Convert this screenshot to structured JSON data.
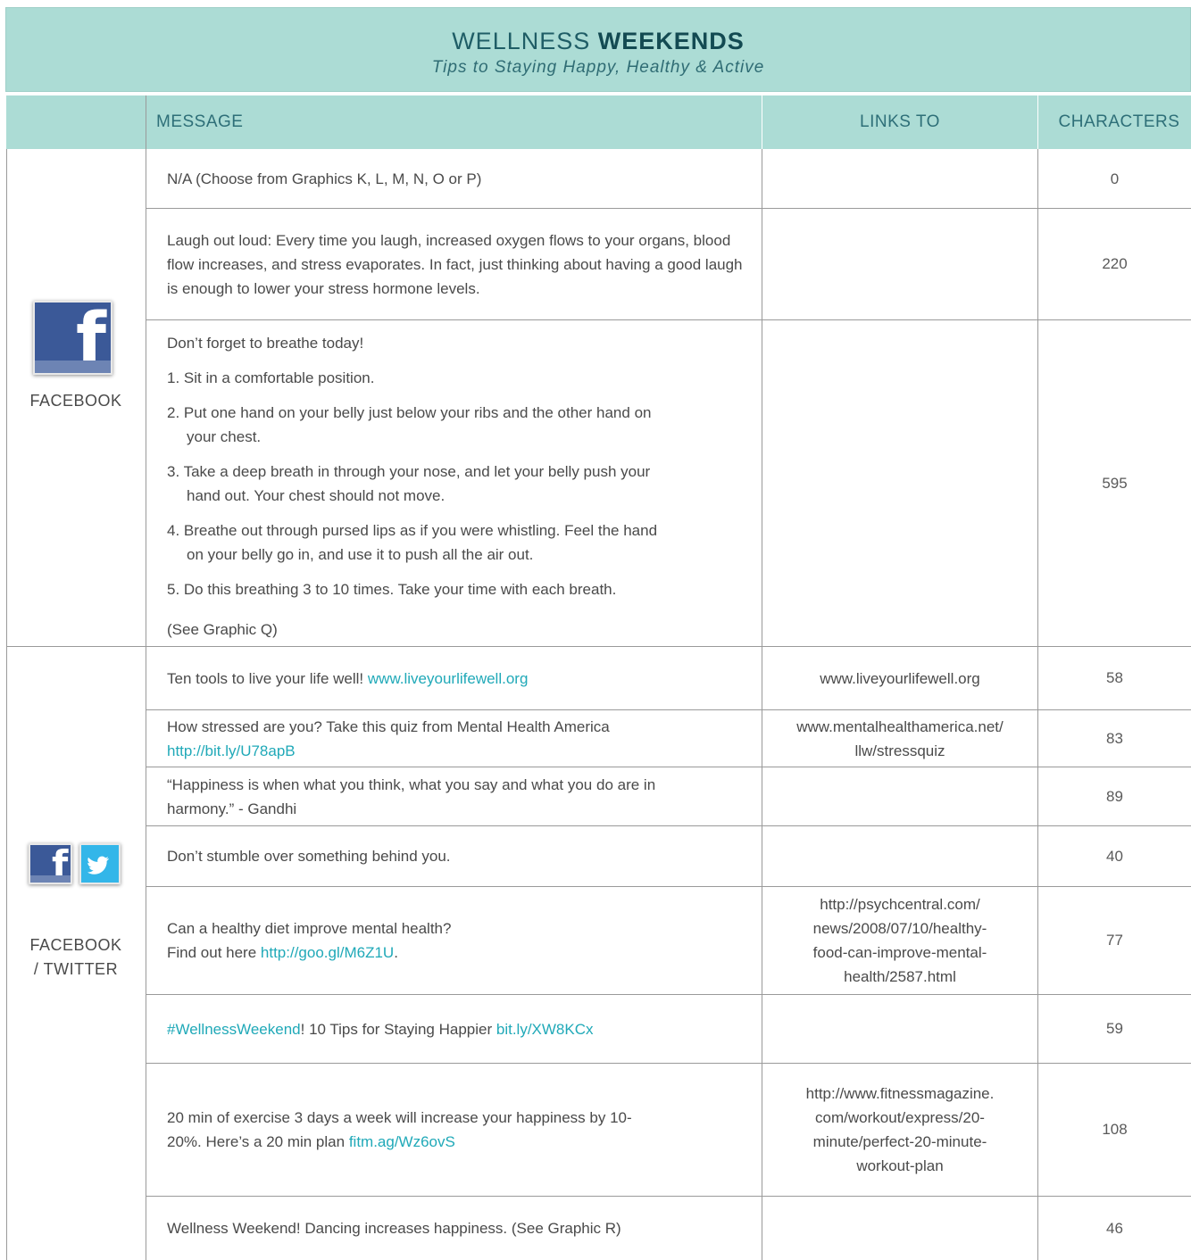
{
  "banner": {
    "title_light": "WELLNESS ",
    "title_bold": "WEEKENDS",
    "subtitle": "Tips to Staying Happy, Healthy & Active"
  },
  "columns": {
    "message": "MESSAGE",
    "links_to": "LINKS TO",
    "characters": "CHARACTERS"
  },
  "platforms": {
    "facebook": "FACEBOOK",
    "fb_twitter_1": "FACEBOOK",
    "fb_twitter_2": "/ TWITTER"
  },
  "icons": {
    "facebook": "facebook-icon",
    "twitter": "twitter-icon"
  },
  "colors": {
    "accent": "#acdcd5",
    "link": "#20a9b8",
    "facebook": "#3b5998",
    "twitter": "#33b6e9"
  },
  "rows": {
    "r1": {
      "message": "N/A (Choose from Graphics K, L, M, N, O or P)",
      "chars": "0"
    },
    "r2": {
      "message": "Laugh out loud:  Every time you laugh, increased oxygen flows to your organs, blood flow increases, and stress evaporates. In fact, just thinking about having a good laugh is enough to lower your stress hormone levels.",
      "chars": "220"
    },
    "r3": {
      "intro": "Don’t forget to breathe today!",
      "s1": "1. Sit in a comfortable position.",
      "s2a": "2. Put one hand on your belly just below your ribs and the other hand on",
      "s2b": "your chest.",
      "s3a": "3. Take a deep breath in through your nose, and let your belly push your",
      "s3b": "hand out. Your chest should not move.",
      "s4a": "4. Breathe out through pursed lips as if you were whistling. Feel the hand",
      "s4b": "on your belly go in, and use it to push all the air out.",
      "s5": "5. Do this breathing 3 to 10 times. Take your time with each breath.",
      "note": "(See Graphic Q)",
      "chars": "595"
    },
    "r4": {
      "text": "Ten tools to live your life well! ",
      "link": "www.liveyourlifewell.org",
      "links_to": "www.liveyourlifewell.org",
      "chars": "58"
    },
    "r5": {
      "text": "How stressed are you? Take this quiz from Mental Health America",
      "link": "http://bit.ly/U78apB",
      "links_to_1": "www.mentalhealthamerica.net/",
      "links_to_2": "llw/stressquiz",
      "chars": "83"
    },
    "r6": {
      "line1": "“Happiness is when what you think, what you say and what you do are in",
      "line2": "harmony.” - Gandhi",
      "chars": "89"
    },
    "r7": {
      "message": "Don’t stumble over something behind you.",
      "chars": "40"
    },
    "r8": {
      "line1": "Can a healthy diet improve mental health?",
      "line2": "Find out here ",
      "link": "http://goo.gl/M6Z1U",
      "after": ".",
      "links_to_1": "http://psychcentral.com/",
      "links_to_2": "news/2008/07/10/healthy-",
      "links_to_3": "food-can-improve-mental-",
      "links_to_4": "health/2587.html",
      "chars": "77"
    },
    "r9": {
      "tag": "#WellnessWeekend",
      "text": "! 10 Tips for Staying Happier ",
      "link": "bit.ly/XW8KCx",
      "chars": "59"
    },
    "r10": {
      "line1": "20 min of exercise 3 days a week will increase your happiness by 10-",
      "line2": "20%. Here’s a 20 min plan ",
      "link": "fitm.ag/Wz6ovS",
      "links_to_1": "http://www.fitnessmagazine.",
      "links_to_2": "com/workout/express/20-",
      "links_to_3": "minute/perfect-20-minute-",
      "links_to_4": "workout-plan",
      "chars": "108"
    },
    "r11": {
      "message": "Wellness Weekend! Dancing increases happiness. (See Graphic R)",
      "chars": "46"
    }
  }
}
